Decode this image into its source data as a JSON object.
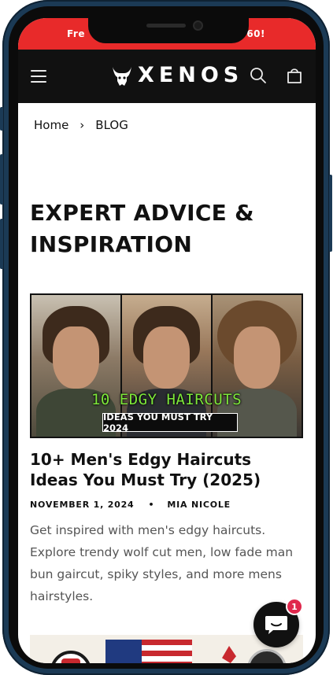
{
  "announcement": {
    "left_text": "Fre",
    "right_text": "60!",
    "bg_color": "#e82a2a"
  },
  "header": {
    "logo_text": "XENOS",
    "icons": [
      "menu-icon",
      "bull-logo-icon",
      "search-icon",
      "cart-icon"
    ],
    "bg_color": "#111111"
  },
  "breadcrumb": {
    "home": "Home",
    "separator": "›",
    "current": "BLOG"
  },
  "page": {
    "title_line1": "EXPERT ADVICE &",
    "title_line2": "INSPIRATION"
  },
  "article": {
    "image_text_green": "10 EDGY HAIRCUTS",
    "image_text_bar": "IDEAS YOU MUST TRY 2024",
    "title": "10+ Men's Edgy Haircuts Ideas You Must Try (2025)",
    "date": "NOVEMBER 1, 2024",
    "separator": "•",
    "author": "MIA NICOLE",
    "excerpt": "Get inspired with men's edgy haircuts. Explore trendy wolf cut men, low fade man bun gaircut, spiky styles, and more mens hairstyles."
  },
  "chat": {
    "badge_count": "1",
    "badge_color": "#e0284d"
  }
}
